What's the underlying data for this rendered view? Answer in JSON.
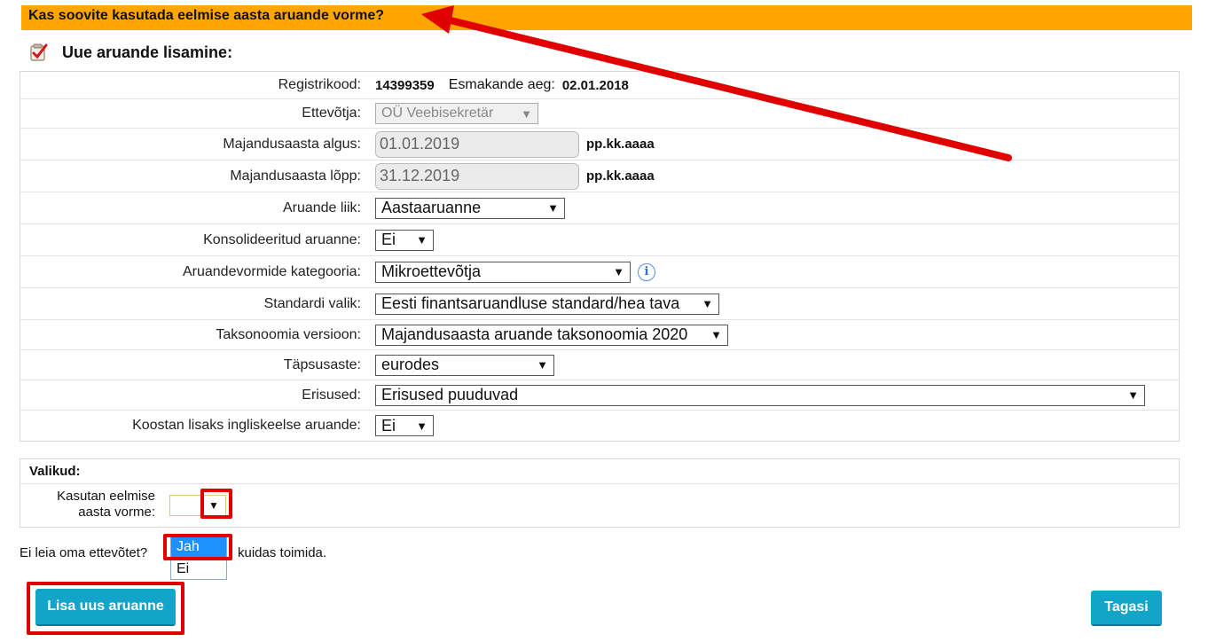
{
  "banner": {
    "text": "Kas soovite kasutada eelmise aasta aruande vorme?"
  },
  "section": {
    "title": "Uue aruande lisamine:",
    "icon": "report-checklist-icon"
  },
  "form": {
    "registrikood_label": "Registrikood:",
    "registrikood_value": "14399359",
    "esmakande_label": "Esmakande aeg:",
    "esmakande_value": "02.01.2018",
    "ettevotja_label": "Ettevõtja:",
    "ettevotja_value": "OÜ Veebisekretär",
    "algus_label": "Majandusaasta algus:",
    "algus_value": "01.01.2019",
    "lopp_label": "Majandusaasta lõpp:",
    "lopp_value": "31.12.2019",
    "date_hint": "pp.kk.aaaa",
    "liik_label": "Aruande liik:",
    "liik_value": "Aastaaruanne",
    "konsolideeritud_label": "Konsolideeritud aruanne:",
    "konsolideeritud_value": "Ei",
    "kategooria_label": "Aruandevormide kategooria:",
    "kategooria_value": "Mikroettevõtja",
    "standard_label": "Standardi valik:",
    "standard_value": "Eesti finantsaruandluse standard/hea tava",
    "taksonoomia_label": "Taksonoomia versioon:",
    "taksonoomia_value": "Majandusaasta aruande taksonoomia 2020",
    "tapsusaste_label": "Täpsusaste:",
    "tapsusaste_value": "eurodes",
    "erisused_label": "Erisused:",
    "erisused_value": "Erisused puuduvad",
    "inglise_label": "Koostan lisaks ingliskeelse aruande:",
    "inglise_value": "Ei"
  },
  "options": {
    "title": "Valikud:",
    "label_line1": "Kasutan eelmise",
    "label_line2": "aasta vorme:",
    "dropdown_items": [
      "Jah",
      "Ei"
    ]
  },
  "help": {
    "text_before": "Ei leia oma ettevõtet?",
    "text_after": "kuidas toimida."
  },
  "buttons": {
    "add": "Lisa uus aruanne",
    "back": "Tagasi"
  },
  "colors": {
    "banner": "#ffa500",
    "button": "#13a5c9",
    "annotation": "#e00000",
    "selected_option": "#1e90ff"
  }
}
